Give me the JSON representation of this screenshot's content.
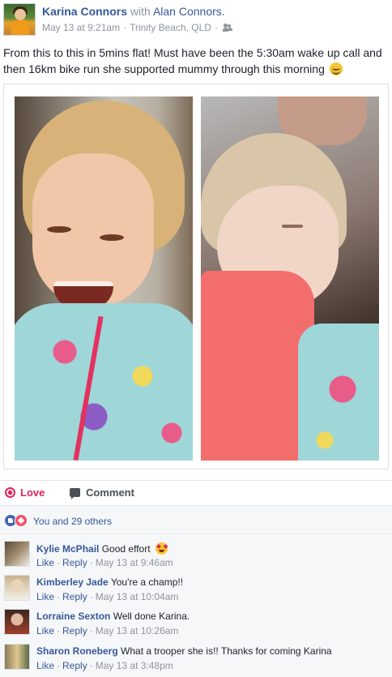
{
  "post": {
    "author": "Karina Connors",
    "with_word": "with",
    "tagged": "Alan Connors.",
    "date": "May 13 at 9:21am",
    "location": "Trinity Beach, QLD",
    "separator": "·",
    "audience_icon": "friends-icon",
    "text": "From this to this in 5mins flat! Must have been the 5:30am wake up call and then 16km bike run she supported mummy through this morning",
    "text_emoji": "smiling-face-icon"
  },
  "actions": {
    "love_label": "Love",
    "comment_label": "Comment"
  },
  "reactions": {
    "summary": "You and 29 others",
    "icons": [
      "like-badge-icon",
      "love-badge-icon"
    ]
  },
  "comments": [
    {
      "name": "Kylie McPhail",
      "text": "Good effort",
      "emoji": "heart-eyes-icon",
      "like": "Like",
      "reply": "Reply",
      "time": "May 13 at 9:46am"
    },
    {
      "name": "Kimberley Jade",
      "text": "You're a champ!!",
      "like": "Like",
      "reply": "Reply",
      "time": "May 13 at 10:04am"
    },
    {
      "name": "Lorraine Sexton",
      "text": "Well done Karina.",
      "like": "Like",
      "reply": "Reply",
      "time": "May 13 at 10:26am"
    },
    {
      "name": "Sharon Roneberg",
      "text": "What a trooper she is!! Thanks for coming Karina",
      "like": "Like",
      "reply": "Reply",
      "time": "May 13 at 3:48pm"
    }
  ],
  "colors": {
    "link": "#365899",
    "love": "#e0245e",
    "muted": "#90949c",
    "text": "#1d2129",
    "background_alt": "#f6f7f9"
  }
}
